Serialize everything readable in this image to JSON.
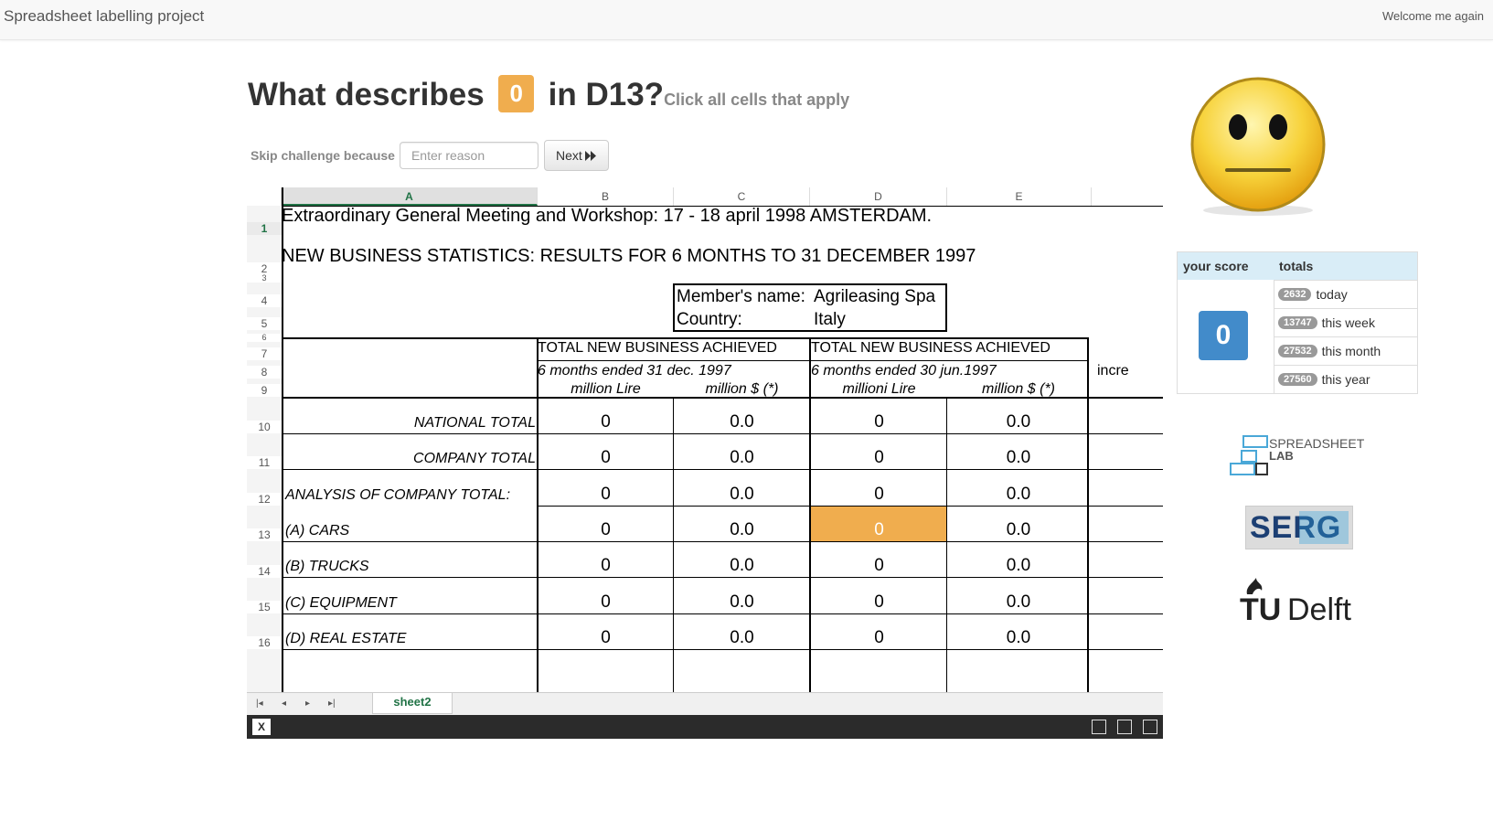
{
  "app": {
    "title": "Spreadsheet labelling project",
    "welcome": "Welcome me again"
  },
  "question": {
    "prefix": "What describes",
    "value": "0",
    "cell_ref": "in D13?",
    "hint": "Click all cells that apply"
  },
  "skip": {
    "label": "Skip challenge because",
    "placeholder": "Enter reason",
    "next_label": "Next"
  },
  "sheet": {
    "columns": [
      "A",
      "B",
      "C",
      "D",
      "E"
    ],
    "active_column": "A",
    "rows": [
      "1",
      "2",
      "3",
      "4",
      "5",
      "6",
      "7",
      "8",
      "9",
      "10",
      "11",
      "12",
      "13",
      "14",
      "15",
      "16"
    ],
    "active_row": "1",
    "title1": "Extraordinary General Meeting and Workshop: 17   - 18 april 1998 AMSTERDAM.",
    "title2": "NEW BUSINESS STATISTICS: RESULTS FOR 6 MONTHS TO 31 DECEMBER 1997",
    "member_label": "Member's name:",
    "member_value": "Agrileasing Spa",
    "country_label": "Country:",
    "country_value": "Italy",
    "block1_header": "TOTAL NEW BUSINESS ACHIEVED",
    "block1_period": "6 months ended 31 dec. 1997",
    "block1_unit1": "million Lire",
    "block1_unit2": "million $ (*)",
    "block2_header": "TOTAL NEW BUSINESS ACHIEVED",
    "block2_period": "6 months ended 30 jun.1997",
    "block2_unit1": "millioni Lire",
    "block2_unit2": "million $ (*)",
    "f_col": "incre",
    "data_rows": [
      {
        "label": "NATIONAL TOTAL",
        "b": "0",
        "c": "0.0",
        "d": "0",
        "e": "0.0"
      },
      {
        "label": "COMPANY TOTAL",
        "b": "0",
        "c": "0.0",
        "d": "0",
        "e": "0.0"
      },
      {
        "label": "ANALYSIS OF COMPANY TOTAL:",
        "b": "0",
        "c": "0.0",
        "d": "0",
        "e": "0.0"
      },
      {
        "label": "(A) CARS",
        "b": "0",
        "c": "0.0",
        "d": "0",
        "e": "0.0"
      },
      {
        "label": "(B) TRUCKS",
        "b": "0",
        "c": "0.0",
        "d": "0",
        "e": "0.0"
      },
      {
        "label": "(C) EQUIPMENT",
        "b": "0",
        "c": "0.0",
        "d": "0",
        "e": "0.0"
      },
      {
        "label": "(D) REAL ESTATE",
        "b": "0",
        "c": "0.0",
        "d": "0",
        "e": "0.0"
      }
    ],
    "tab_name": "sheet2",
    "selected_cell": "D13"
  },
  "score": {
    "your_score_label": "your score",
    "totals_label": "totals",
    "value": "0",
    "totals": [
      {
        "count": "2632",
        "label": "today"
      },
      {
        "count": "13747",
        "label": "this week"
      },
      {
        "count": "27532",
        "label": "this month"
      },
      {
        "count": "27560",
        "label": "this year"
      }
    ]
  },
  "logos": {
    "lab_line1": "SPREADSHEET",
    "lab_line2": "LAB",
    "serg": "SERG",
    "tu": "TU",
    "delft": "Delft"
  },
  "colors": {
    "accent": "#f0ad4e",
    "score_blue": "#428bca",
    "excel_green": "#217346"
  }
}
